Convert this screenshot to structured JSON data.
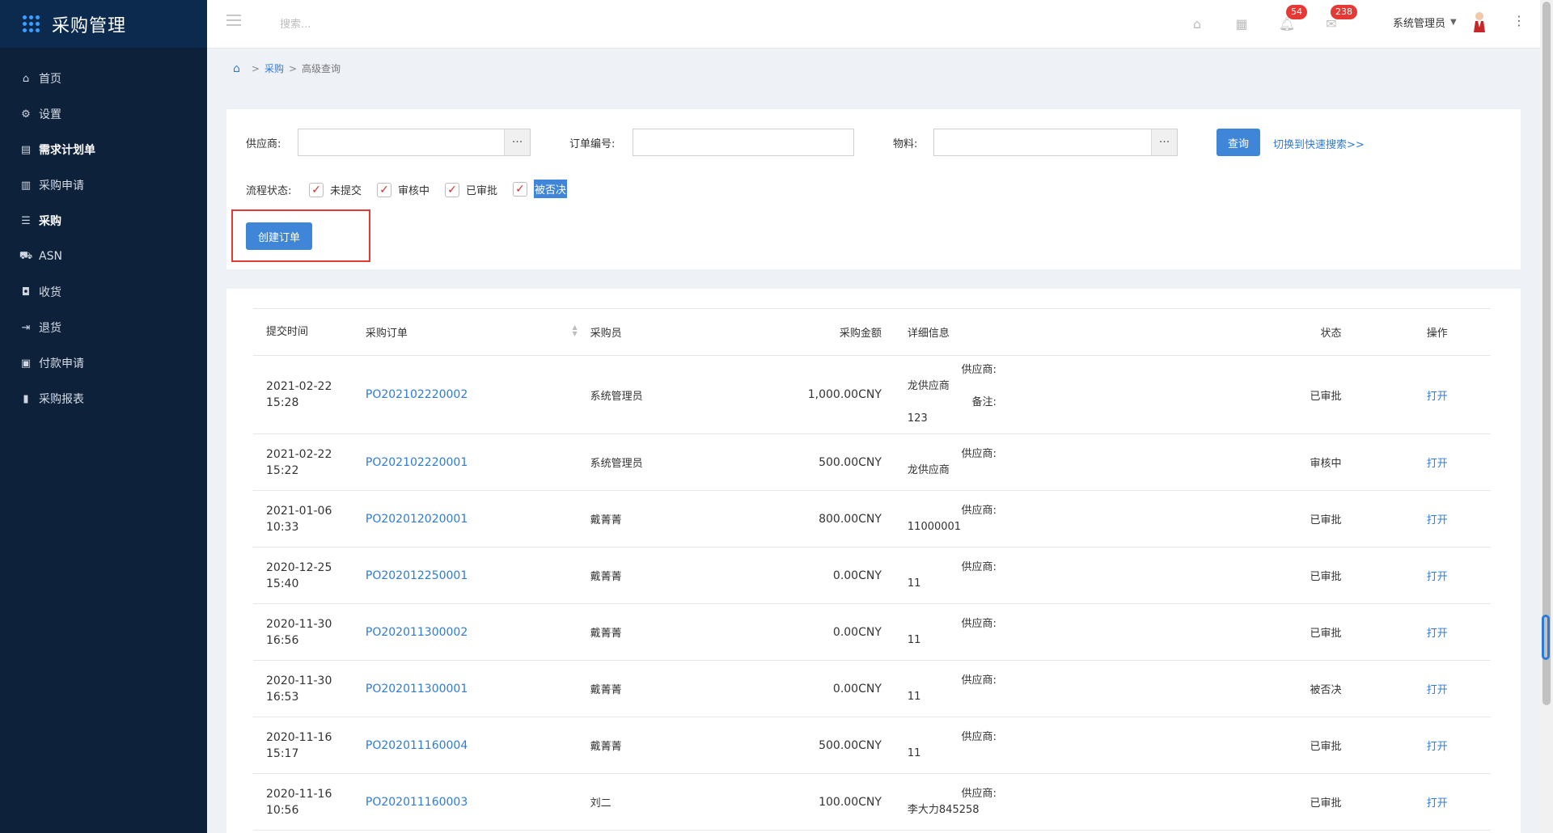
{
  "brand": {
    "title": "采购管理"
  },
  "nav": [
    {
      "label": "首页",
      "icon": "home-icon",
      "active": false
    },
    {
      "label": "设置",
      "icon": "gear-icon",
      "active": false
    },
    {
      "label": "需求计划单",
      "icon": "document-icon",
      "active": true
    },
    {
      "label": "采购申请",
      "icon": "clipboard-icon",
      "active": false
    },
    {
      "label": "采购",
      "icon": "list-icon",
      "active": true
    },
    {
      "label": "ASN",
      "icon": "truck-icon",
      "active": false
    },
    {
      "label": "收货",
      "icon": "inbox-icon",
      "active": false
    },
    {
      "label": "退货",
      "icon": "return-icon",
      "active": false
    },
    {
      "label": "付款申请",
      "icon": "payment-icon",
      "active": false
    },
    {
      "label": "采购报表",
      "icon": "bar-chart-icon",
      "active": false
    }
  ],
  "header": {
    "search_placeholder": "搜索...",
    "notifications_count": "54",
    "messages_count": "238",
    "user_name": "系统管理员"
  },
  "breadcrumb": {
    "level1": "采购",
    "level2": "高级查询"
  },
  "filters": {
    "supplier_label": "供应商:",
    "order_no_label": "订单编号:",
    "material_label": "物料:",
    "query_button": "查询",
    "switch_link": "切换到快速搜索>>",
    "status_label": "流程状态:",
    "statuses": [
      "未提交",
      "审核中",
      "已审批",
      "被否决"
    ],
    "create_button": "创建订单"
  },
  "table": {
    "headers": {
      "time": "提交时间",
      "order": "采购订单",
      "buyer": "采购员",
      "amount": "采购金额",
      "detail": "详细信息",
      "status": "状态",
      "op": "操作"
    },
    "rows": [
      {
        "date": "2021-02-22",
        "time": "15:28",
        "po": "PO202102220002",
        "buyer": "系统管理员",
        "amount": "1,000.00CNY",
        "supplier_label": "供应商:",
        "supplier": "龙供应商",
        "note_label": "备注:",
        "note": "123",
        "status": "已审批",
        "op": "打开"
      },
      {
        "date": "2021-02-22",
        "time": "15:22",
        "po": "PO202102220001",
        "buyer": "系统管理员",
        "amount": "500.00CNY",
        "supplier_label": "供应商:",
        "supplier": "龙供应商",
        "status": "审核中",
        "op": "打开"
      },
      {
        "date": "2021-01-06",
        "time": "10:33",
        "po": "PO202012020001",
        "buyer": "戴菁菁",
        "amount": "800.00CNY",
        "supplier_label": "供应商:",
        "supplier": "11000001",
        "status": "已审批",
        "op": "打开"
      },
      {
        "date": "2020-12-25",
        "time": "15:40",
        "po": "PO202012250001",
        "buyer": "戴菁菁",
        "amount": "0.00CNY",
        "supplier_label": "供应商:",
        "supplier": "11",
        "status": "已审批",
        "op": "打开"
      },
      {
        "date": "2020-11-30",
        "time": "16:56",
        "po": "PO202011300002",
        "buyer": "戴菁菁",
        "amount": "0.00CNY",
        "supplier_label": "供应商:",
        "supplier": "11",
        "status": "已审批",
        "op": "打开"
      },
      {
        "date": "2020-11-30",
        "time": "16:53",
        "po": "PO202011300001",
        "buyer": "戴菁菁",
        "amount": "0.00CNY",
        "supplier_label": "供应商:",
        "supplier": "11",
        "status": "被否决",
        "op": "打开"
      },
      {
        "date": "2020-11-16",
        "time": "15:17",
        "po": "PO202011160004",
        "buyer": "戴菁菁",
        "amount": "500.00CNY",
        "supplier_label": "供应商:",
        "supplier": "11",
        "status": "已审批",
        "op": "打开"
      },
      {
        "date": "2020-11-16",
        "time": "10:56",
        "po": "PO202011160003",
        "buyer": "刘二",
        "amount": "100.00CNY",
        "supplier_label": "供应商:",
        "supplier": "李大力845258",
        "status": "已审批",
        "op": "打开"
      }
    ]
  },
  "colors": {
    "sidebar": "#0d213a",
    "accent": "#3f86d8",
    "link": "#2e7bd6",
    "badge": "#e53935"
  }
}
